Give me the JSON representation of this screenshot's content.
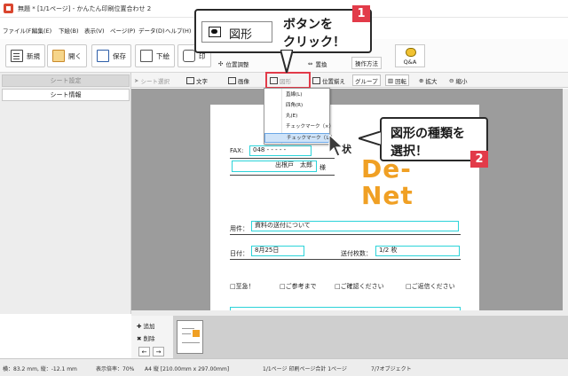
{
  "titlebar": {
    "title": "無題 * [1/1ページ] - かんたん印刷位置合わせ 2"
  },
  "menu": [
    "ファイル(F)",
    "編集(E)",
    "下絵(B)",
    "表示(V)",
    "ページ(P)",
    "データ(D)",
    "ヘルプ(H)"
  ],
  "toolbar": {
    "new": "新規",
    "open": "開く",
    "save": "保存",
    "underlay": "下絵",
    "print": "印",
    "position_adjust": "位置調整",
    "replace": "置換",
    "operation": "操作方法",
    "qa": "Q&A"
  },
  "page_toolbar": {
    "select": "シート選択",
    "text": "文字",
    "image": "画像",
    "shape": "図形",
    "align": "位置揃え",
    "group": "グループ",
    "rotate": "回転",
    "zoom_in": "拡大",
    "zoom_out": "縮小"
  },
  "sidebar": {
    "tab_settings": "シート設定",
    "tab_info": "シート情報"
  },
  "shape_menu": {
    "items": [
      "直線(L)",
      "四角(R)",
      "丸(E)",
      "チェックマーク（×）",
      "チェックマーク（レ）"
    ],
    "selected_index": 4
  },
  "form": {
    "fax_label": "FAX:",
    "fax_value": "048 - - - - -",
    "recipient": "出根戸　太郎",
    "honorific": "様",
    "title_partial": "状",
    "logo_line1": "De-",
    "logo_line2": "Net",
    "subject_label": "用件：",
    "subject_value": "資料の送付について",
    "date_label": "日付：",
    "date_value": "8月25日",
    "pages_label": "送付枚数：",
    "pages_value": "1/2 枚",
    "checkboxes": [
      "□至急！",
      "□ご参考まで",
      "□ご確認ください",
      "□ご返信ください"
    ]
  },
  "callouts": {
    "c1_button": "図形",
    "c1_line1": "ボタンを",
    "c1_line2": "クリック！",
    "c1_step": "1",
    "c2_line1": "図形の種類を",
    "c2_line2": "選択！",
    "c2_step": "2"
  },
  "thumbs": {
    "add": "追加",
    "delete": "削除"
  },
  "status": {
    "coords": "横：83.2 mm, 縦：-12.1 mm",
    "zoom": "表示倍率：70%",
    "paper": "A4 縦 [210.00mm x 297.00mm]",
    "pages": "1/1ページ 印刷ページ合計 1ページ",
    "objects": "7/7オブジェクト"
  },
  "colors": {
    "accent_red": "#e23b49",
    "field_cyan": "#2cd3d9",
    "logo_orange": "#f0a024"
  }
}
